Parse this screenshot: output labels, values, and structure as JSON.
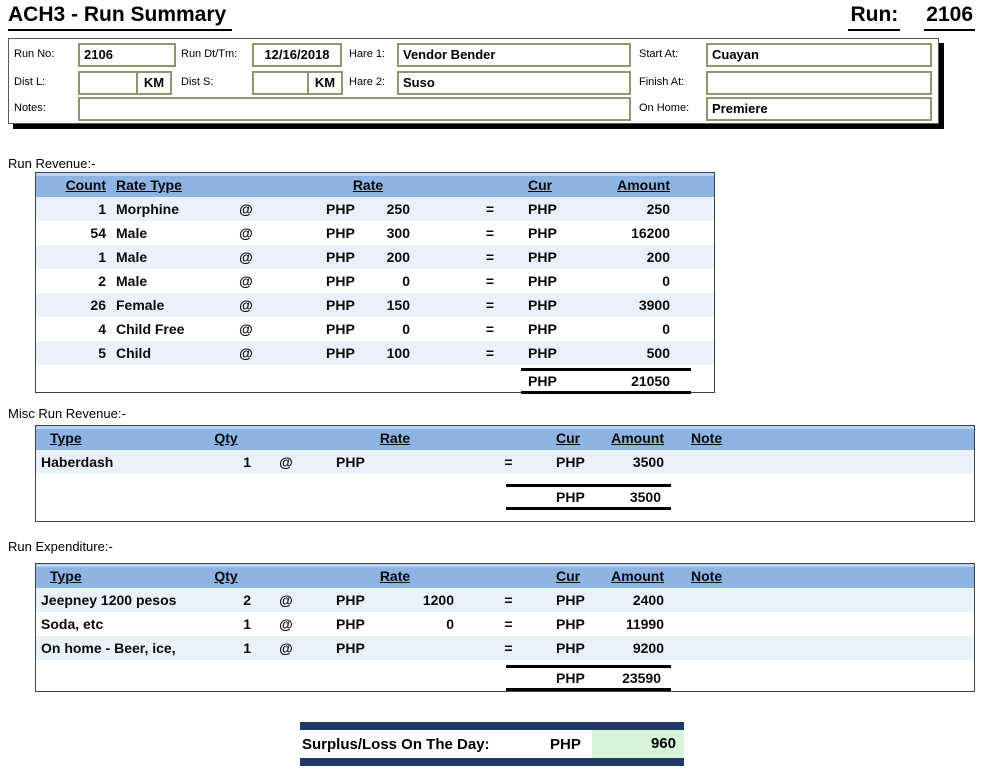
{
  "page": {
    "title": "ACH3 - Run Summary",
    "run_label": "Run:",
    "run_number": "2106"
  },
  "header_form": {
    "run_no": {
      "label": "Run No:",
      "value": "2106"
    },
    "run_dttm": {
      "label": "Run Dt/Tm:",
      "value": "12/16/2018"
    },
    "hare1": {
      "label": "Hare 1:",
      "value": "Vendor Bender"
    },
    "start_at": {
      "label": "Start At:",
      "value": "Cuayan"
    },
    "dist_l": {
      "label": "Dist L:",
      "value": "",
      "unit": "KM"
    },
    "dist_s": {
      "label": "Dist S:",
      "value": "",
      "unit": "KM"
    },
    "hare2": {
      "label": "Hare 2:",
      "value": "Suso"
    },
    "finish_at": {
      "label": "Finish At:",
      "value": ""
    },
    "notes": {
      "label": "Notes:",
      "value": ""
    },
    "on_home": {
      "label": "On Home:",
      "value": "Premiere"
    }
  },
  "revenue": {
    "section_label": "Run Revenue:-",
    "headers": {
      "count": "Count",
      "rate_type": "Rate Type",
      "rate": "Rate",
      "cur": "Cur",
      "amount": "Amount"
    },
    "rows": [
      {
        "count": "1",
        "type": "Morphine",
        "at": "@",
        "rate_cur": "PHP",
        "rate": "250",
        "eq": "=",
        "cur": "PHP",
        "amount": "250"
      },
      {
        "count": "54",
        "type": "Male",
        "at": "@",
        "rate_cur": "PHP",
        "rate": "300",
        "eq": "=",
        "cur": "PHP",
        "amount": "16200"
      },
      {
        "count": "1",
        "type": "Male",
        "at": "@",
        "rate_cur": "PHP",
        "rate": "200",
        "eq": "=",
        "cur": "PHP",
        "amount": "200"
      },
      {
        "count": "2",
        "type": "Male",
        "at": "@",
        "rate_cur": "PHP",
        "rate": "0",
        "eq": "=",
        "cur": "PHP",
        "amount": "0"
      },
      {
        "count": "26",
        "type": "Female",
        "at": "@",
        "rate_cur": "PHP",
        "rate": "150",
        "eq": "=",
        "cur": "PHP",
        "amount": "3900"
      },
      {
        "count": "4",
        "type": "Child Free",
        "at": "@",
        "rate_cur": "PHP",
        "rate": "0",
        "eq": "=",
        "cur": "PHP",
        "amount": "0"
      },
      {
        "count": "5",
        "type": "Child",
        "at": "@",
        "rate_cur": "PHP",
        "rate": "100",
        "eq": "=",
        "cur": "PHP",
        "amount": "500"
      }
    ],
    "total": {
      "cur": "PHP",
      "amount": "21050"
    }
  },
  "misc_revenue": {
    "section_label": "Misc Run Revenue:-",
    "headers": {
      "type": "Type",
      "qty": "Qty",
      "rate": "Rate",
      "cur": "Cur",
      "amount": "Amount",
      "note": "Note"
    },
    "rows": [
      {
        "type": "Haberdash",
        "qty": "1",
        "at": "@",
        "rate_cur": "PHP",
        "rate": "",
        "eq": "=",
        "cur": "PHP",
        "amount": "3500",
        "note": ""
      }
    ],
    "total": {
      "cur": "PHP",
      "amount": "3500"
    }
  },
  "expenditure": {
    "section_label": "Run Expenditure:-",
    "headers": {
      "type": "Type",
      "qty": "Qty",
      "rate": "Rate",
      "cur": "Cur",
      "amount": "Amount",
      "note": "Note"
    },
    "rows": [
      {
        "type": "Jeepney 1200 pesos",
        "qty": "2",
        "at": "@",
        "rate_cur": "PHP",
        "rate": "1200",
        "eq": "=",
        "cur": "PHP",
        "amount": "2400",
        "note": ""
      },
      {
        "type": "Soda, etc",
        "qty": "1",
        "at": "@",
        "rate_cur": "PHP",
        "rate": "0",
        "eq": "=",
        "cur": "PHP",
        "amount": "11990",
        "note": ""
      },
      {
        "type": "On home - Beer, ice,",
        "qty": "1",
        "at": "@",
        "rate_cur": "PHP",
        "rate": "",
        "eq": "=",
        "cur": "PHP",
        "amount": "9200",
        "note": ""
      }
    ],
    "total": {
      "cur": "PHP",
      "amount": "23590"
    }
  },
  "surplus": {
    "label": "Surplus/Loss On The Day:",
    "cur": "PHP",
    "amount": "960"
  },
  "colors": {
    "table_header_blue": "#8DB4E2",
    "table_header_strip": "#BAD2F3",
    "row_alt_blue": "#E9F1FA",
    "navy_bar": "#1F3864",
    "surplus_green": "#D6F5D8",
    "input_border_olive": "#8A9A6B"
  }
}
